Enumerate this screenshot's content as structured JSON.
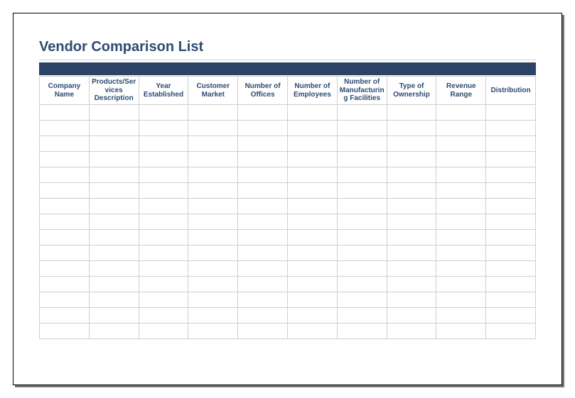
{
  "title": "Vendor Comparison List",
  "columns": [
    "Company Name",
    "Products/Services Description",
    "Year Established",
    "Customer Market",
    "Number of Offices",
    "Number of Employees",
    "Number of Manufacturing Facilities",
    "Type of Ownership",
    "Revenue Range",
    "Distribution"
  ],
  "rows": [
    [
      "",
      "",
      "",
      "",
      "",
      "",
      "",
      "",
      "",
      ""
    ],
    [
      "",
      "",
      "",
      "",
      "",
      "",
      "",
      "",
      "",
      ""
    ],
    [
      "",
      "",
      "",
      "",
      "",
      "",
      "",
      "",
      "",
      ""
    ],
    [
      "",
      "",
      "",
      "",
      "",
      "",
      "",
      "",
      "",
      ""
    ],
    [
      "",
      "",
      "",
      "",
      "",
      "",
      "",
      "",
      "",
      ""
    ],
    [
      "",
      "",
      "",
      "",
      "",
      "",
      "",
      "",
      "",
      ""
    ],
    [
      "",
      "",
      "",
      "",
      "",
      "",
      "",
      "",
      "",
      ""
    ],
    [
      "",
      "",
      "",
      "",
      "",
      "",
      "",
      "",
      "",
      ""
    ],
    [
      "",
      "",
      "",
      "",
      "",
      "",
      "",
      "",
      "",
      ""
    ],
    [
      "",
      "",
      "",
      "",
      "",
      "",
      "",
      "",
      "",
      ""
    ],
    [
      "",
      "",
      "",
      "",
      "",
      "",
      "",
      "",
      "",
      ""
    ],
    [
      "",
      "",
      "",
      "",
      "",
      "",
      "",
      "",
      "",
      ""
    ],
    [
      "",
      "",
      "",
      "",
      "",
      "",
      "",
      "",
      "",
      ""
    ],
    [
      "",
      "",
      "",
      "",
      "",
      "",
      "",
      "",
      "",
      ""
    ],
    [
      "",
      "",
      "",
      "",
      "",
      "",
      "",
      "",
      "",
      ""
    ]
  ],
  "chart_data": {
    "type": "table",
    "title": "Vendor Comparison List",
    "columns": [
      "Company Name",
      "Products/Services Description",
      "Year Established",
      "Customer Market",
      "Number of Offices",
      "Number of Employees",
      "Number of Manufacturing Facilities",
      "Type of Ownership",
      "Revenue Range",
      "Distribution"
    ],
    "rows": []
  }
}
